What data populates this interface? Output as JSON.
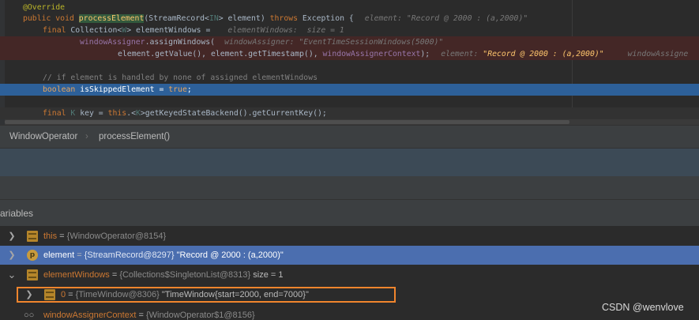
{
  "editor": {
    "annotation": "@Override",
    "line2": {
      "kw1": "public void ",
      "method": "processElement",
      "pre_type": "(StreamRecord<",
      "type_param": "IN",
      "post_type": "> element) ",
      "kw_throws": "throws",
      "rest": " Exception {",
      "hint": "element: ",
      "hint_value": "\"Record @ 2000 : (a,2000)\""
    },
    "line3": {
      "kw_final": "final",
      "pre": " Collection<",
      "type_param": "W",
      "post": "> elementWindows =",
      "hint": "elementWindows:  size = 1"
    },
    "line4": {
      "field": "windowAssigner",
      "call": ".assignWindows(",
      "hint": "windowAssigner: \"EventTimeSessionWindows(5000)\""
    },
    "line5": {
      "code": "element.getValue(), element.getTimestamp(), ",
      "field": "windowAssignerContext",
      "end": ");",
      "hint": "element: ",
      "hint_value": "\"Record @ 2000 : (a,2000)\"",
      "hint2": "windowAssigne"
    },
    "line7_comment": "// if element is handled by none of assigned elementWindows",
    "line8": {
      "kw": "boolean",
      "code": " isSkippedElement = ",
      "kw_true": "true",
      "end": ";"
    },
    "line10": {
      "kw_final": "final",
      "type_param": "K",
      "pre": " key = ",
      "kw_this": "this",
      "mid": ".<",
      "type_param2": "K",
      "rest": ">getKeyedStateBackend().getCurrentKey();"
    }
  },
  "breadcrumb": {
    "class_name": "WindowOperator",
    "method_name": "processElement()"
  },
  "variables_panel": {
    "title": "ariables",
    "rows": [
      {
        "toggle": "❯",
        "icon": "field-icon",
        "name": "this",
        "eq": " = ",
        "ref": "{WindowOperator@8154}",
        "value": ""
      },
      {
        "toggle": "❯",
        "icon": "parameter-icon",
        "icon_letter": "p",
        "name": "element",
        "eq": " = ",
        "ref": "{StreamRecord@8297}",
        "value": " \"Record @ 2000 : (a,2000)\""
      },
      {
        "toggle": "⌄",
        "icon": "field-icon",
        "name": "elementWindows",
        "eq": " = ",
        "ref": "{Collections$SingletonList@8313}",
        "value": "  size = 1"
      },
      {
        "toggle": "❯",
        "icon": "field-icon",
        "name": "0",
        "eq": " = ",
        "ref": "{TimeWindow@8306}",
        "value": " \"TimeWindow{start=2000, end=7000}\""
      },
      {
        "toggle": "",
        "icon": "watch-icon",
        "name": "windowAssignerContext",
        "eq": " = ",
        "ref": "{WindowOperator$1@8156}",
        "value": ""
      }
    ]
  },
  "watermark": "CSDN @wenvlove"
}
